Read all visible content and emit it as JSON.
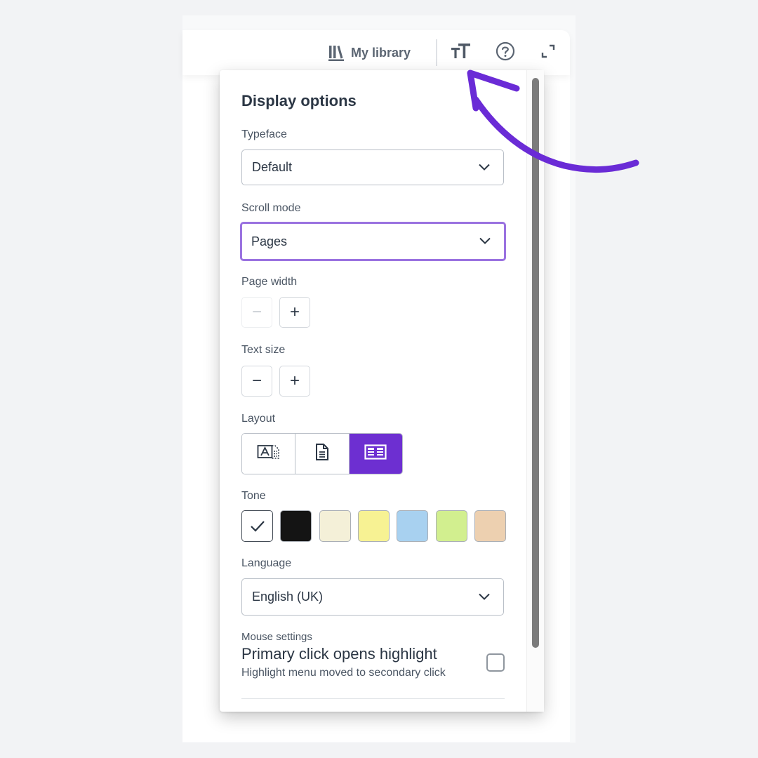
{
  "toolbar": {
    "library_label": "My library",
    "icons": [
      "library-icon",
      "text-size-icon",
      "help-icon",
      "expand-icon"
    ]
  },
  "panel": {
    "title": "Display options",
    "typeface": {
      "label": "Typeface",
      "value": "Default"
    },
    "scroll_mode": {
      "label": "Scroll mode",
      "value": "Pages"
    },
    "page_width": {
      "label": "Page width",
      "decrease": "−",
      "increase": "+"
    },
    "text_size": {
      "label": "Text size",
      "decrease": "−",
      "increase": "+"
    },
    "layout": {
      "label": "Layout",
      "options": [
        "translate-layout-icon",
        "document-layout-icon",
        "columns-layout-icon"
      ],
      "selected_index": 2
    },
    "tone": {
      "label": "Tone",
      "swatches": [
        "#ffffff",
        "#141414",
        "#f4f0d8",
        "#f7f293",
        "#a8d1f0",
        "#d2ef8f",
        "#edd0b0"
      ],
      "selected_index": 0
    },
    "language": {
      "label": "Language",
      "value": "English (UK)"
    },
    "mouse": {
      "section_label": "Mouse settings",
      "title": "Primary click opens highlight",
      "subtitle": "Highlight menu moved to secondary click",
      "checked": false
    }
  },
  "colors": {
    "accent": "#6d2fd1",
    "focus_border": "#9a72e0",
    "annotation_arrow": "#6a2bd6"
  }
}
